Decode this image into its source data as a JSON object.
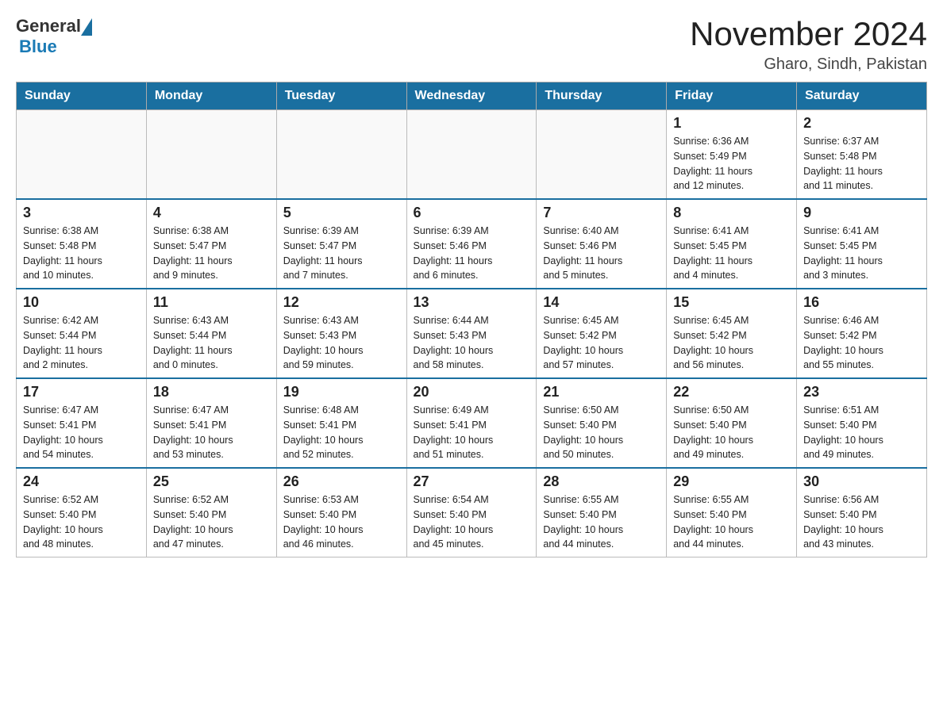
{
  "header": {
    "logo_general": "General",
    "logo_blue": "Blue",
    "title": "November 2024",
    "subtitle": "Gharo, Sindh, Pakistan"
  },
  "weekdays": [
    "Sunday",
    "Monday",
    "Tuesday",
    "Wednesday",
    "Thursday",
    "Friday",
    "Saturday"
  ],
  "weeks": [
    [
      {
        "day": "",
        "info": ""
      },
      {
        "day": "",
        "info": ""
      },
      {
        "day": "",
        "info": ""
      },
      {
        "day": "",
        "info": ""
      },
      {
        "day": "",
        "info": ""
      },
      {
        "day": "1",
        "info": "Sunrise: 6:36 AM\nSunset: 5:49 PM\nDaylight: 11 hours\nand 12 minutes."
      },
      {
        "day": "2",
        "info": "Sunrise: 6:37 AM\nSunset: 5:48 PM\nDaylight: 11 hours\nand 11 minutes."
      }
    ],
    [
      {
        "day": "3",
        "info": "Sunrise: 6:38 AM\nSunset: 5:48 PM\nDaylight: 11 hours\nand 10 minutes."
      },
      {
        "day": "4",
        "info": "Sunrise: 6:38 AM\nSunset: 5:47 PM\nDaylight: 11 hours\nand 9 minutes."
      },
      {
        "day": "5",
        "info": "Sunrise: 6:39 AM\nSunset: 5:47 PM\nDaylight: 11 hours\nand 7 minutes."
      },
      {
        "day": "6",
        "info": "Sunrise: 6:39 AM\nSunset: 5:46 PM\nDaylight: 11 hours\nand 6 minutes."
      },
      {
        "day": "7",
        "info": "Sunrise: 6:40 AM\nSunset: 5:46 PM\nDaylight: 11 hours\nand 5 minutes."
      },
      {
        "day": "8",
        "info": "Sunrise: 6:41 AM\nSunset: 5:45 PM\nDaylight: 11 hours\nand 4 minutes."
      },
      {
        "day": "9",
        "info": "Sunrise: 6:41 AM\nSunset: 5:45 PM\nDaylight: 11 hours\nand 3 minutes."
      }
    ],
    [
      {
        "day": "10",
        "info": "Sunrise: 6:42 AM\nSunset: 5:44 PM\nDaylight: 11 hours\nand 2 minutes."
      },
      {
        "day": "11",
        "info": "Sunrise: 6:43 AM\nSunset: 5:44 PM\nDaylight: 11 hours\nand 0 minutes."
      },
      {
        "day": "12",
        "info": "Sunrise: 6:43 AM\nSunset: 5:43 PM\nDaylight: 10 hours\nand 59 minutes."
      },
      {
        "day": "13",
        "info": "Sunrise: 6:44 AM\nSunset: 5:43 PM\nDaylight: 10 hours\nand 58 minutes."
      },
      {
        "day": "14",
        "info": "Sunrise: 6:45 AM\nSunset: 5:42 PM\nDaylight: 10 hours\nand 57 minutes."
      },
      {
        "day": "15",
        "info": "Sunrise: 6:45 AM\nSunset: 5:42 PM\nDaylight: 10 hours\nand 56 minutes."
      },
      {
        "day": "16",
        "info": "Sunrise: 6:46 AM\nSunset: 5:42 PM\nDaylight: 10 hours\nand 55 minutes."
      }
    ],
    [
      {
        "day": "17",
        "info": "Sunrise: 6:47 AM\nSunset: 5:41 PM\nDaylight: 10 hours\nand 54 minutes."
      },
      {
        "day": "18",
        "info": "Sunrise: 6:47 AM\nSunset: 5:41 PM\nDaylight: 10 hours\nand 53 minutes."
      },
      {
        "day": "19",
        "info": "Sunrise: 6:48 AM\nSunset: 5:41 PM\nDaylight: 10 hours\nand 52 minutes."
      },
      {
        "day": "20",
        "info": "Sunrise: 6:49 AM\nSunset: 5:41 PM\nDaylight: 10 hours\nand 51 minutes."
      },
      {
        "day": "21",
        "info": "Sunrise: 6:50 AM\nSunset: 5:40 PM\nDaylight: 10 hours\nand 50 minutes."
      },
      {
        "day": "22",
        "info": "Sunrise: 6:50 AM\nSunset: 5:40 PM\nDaylight: 10 hours\nand 49 minutes."
      },
      {
        "day": "23",
        "info": "Sunrise: 6:51 AM\nSunset: 5:40 PM\nDaylight: 10 hours\nand 49 minutes."
      }
    ],
    [
      {
        "day": "24",
        "info": "Sunrise: 6:52 AM\nSunset: 5:40 PM\nDaylight: 10 hours\nand 48 minutes."
      },
      {
        "day": "25",
        "info": "Sunrise: 6:52 AM\nSunset: 5:40 PM\nDaylight: 10 hours\nand 47 minutes."
      },
      {
        "day": "26",
        "info": "Sunrise: 6:53 AM\nSunset: 5:40 PM\nDaylight: 10 hours\nand 46 minutes."
      },
      {
        "day": "27",
        "info": "Sunrise: 6:54 AM\nSunset: 5:40 PM\nDaylight: 10 hours\nand 45 minutes."
      },
      {
        "day": "28",
        "info": "Sunrise: 6:55 AM\nSunset: 5:40 PM\nDaylight: 10 hours\nand 44 minutes."
      },
      {
        "day": "29",
        "info": "Sunrise: 6:55 AM\nSunset: 5:40 PM\nDaylight: 10 hours\nand 44 minutes."
      },
      {
        "day": "30",
        "info": "Sunrise: 6:56 AM\nSunset: 5:40 PM\nDaylight: 10 hours\nand 43 minutes."
      }
    ]
  ]
}
